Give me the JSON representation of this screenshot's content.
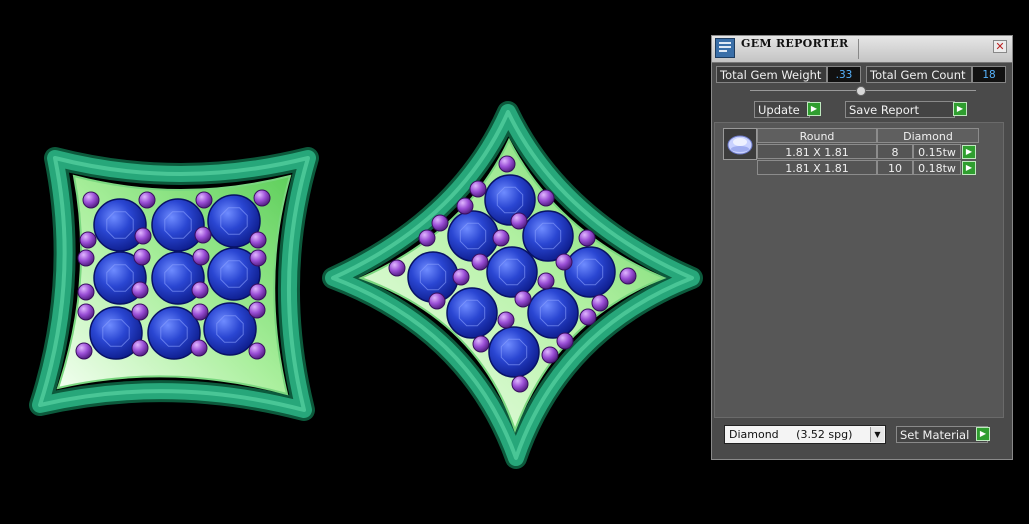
{
  "viewport": {
    "colors": {
      "background": "#000000",
      "frame_green": "#1e8f68",
      "inner_green": "#a9ef9c",
      "gem_blue": "#1f38c0",
      "prong_purple": "#8a3fc4"
    },
    "gem_counts": {
      "left_earring": 9,
      "right_earring": 9
    }
  },
  "panel": {
    "title": "GEM REPORTER",
    "close_icon": "close-icon",
    "total_weight": {
      "label": "Total Gem Weight",
      "value": ".33"
    },
    "total_count": {
      "label": "Total Gem Count",
      "value": "18"
    },
    "update_label": "Update",
    "save_report_label": "Save Report",
    "table": {
      "headers": [
        "Round",
        "Diamond"
      ],
      "rows": [
        {
          "size": "1.81 X 1.81",
          "count": "8",
          "weight": "0.15tw"
        },
        {
          "size": "1.81 X 1.81",
          "count": "10",
          "weight": "0.18tw"
        }
      ]
    },
    "material": {
      "value": "Diamond     (3.52 spg)"
    },
    "set_material_label": "Set Material",
    "accent": "#2f9e2f"
  }
}
